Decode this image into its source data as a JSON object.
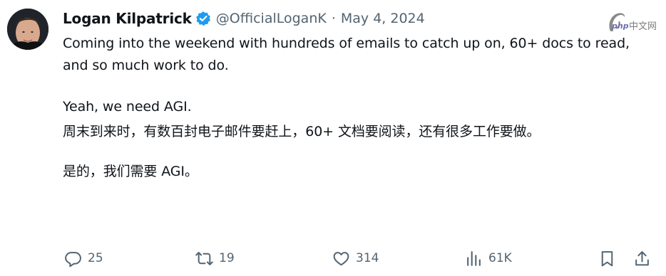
{
  "tweet": {
    "author_name": "Logan Kilpatrick",
    "handle": "@OfficialLoganK",
    "separator": "·",
    "date": "May 4, 2024",
    "paragraphs": [
      "Coming into the weekend with hundreds of emails to catch up on, 60+ docs to read, and so much work to do.",
      "Yeah, we need AGI.",
      "周末到来时，有数百封电子邮件要赶上，60+ 文档要阅读，还有很多工作要做。",
      "是的，我们需要 AGI。"
    ]
  },
  "actions": {
    "replies": "25",
    "retweets": "19",
    "likes": "314",
    "views": "61K"
  },
  "watermark": {
    "brand": "php",
    "text": "中文网"
  },
  "colors": {
    "text": "#0f1419",
    "secondary": "#536471",
    "verified": "#1d9bf0"
  },
  "icons": [
    "verified-badge-icon",
    "reply-icon",
    "retweet-icon",
    "like-icon",
    "views-icon",
    "bookmark-icon",
    "share-icon"
  ]
}
